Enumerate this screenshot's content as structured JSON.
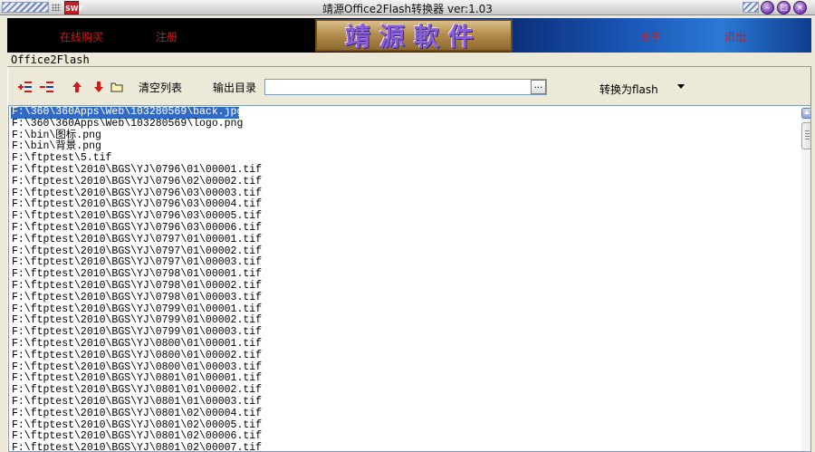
{
  "window": {
    "title": "靖源Office2Flash转换器 ver:1.03",
    "app_icon_text": "SWF",
    "buttons": [
      "minimize",
      "maximize",
      "close"
    ]
  },
  "banner": {
    "buy_online": "在线购买",
    "register": "注册",
    "logo_text": "靖源軟件",
    "about": "关于",
    "exit": "退出"
  },
  "tab": {
    "label": "Office2Flash"
  },
  "toolbar": {
    "add_files_icon": "add-files-icon",
    "remove_files_icon": "remove-files-icon",
    "move_up_icon": "arrow-up-icon",
    "move_down_icon": "arrow-down-icon",
    "folder_icon": "folder-icon",
    "clear_list_label": "清空列表",
    "output_dir_label": "输出目录",
    "output_dir_value": "",
    "browse_label": "...",
    "convert_label": "转换为flash"
  },
  "file_list": {
    "selected_index": 0,
    "items": [
      "F:\\360\\360Apps\\Web\\103280569\\back.jpg",
      "F:\\360\\360Apps\\Web\\103280569\\logo.png",
      "F:\\bin\\图标.png",
      "F:\\bin\\背景.png",
      "F:\\ftptest\\5.tif",
      "F:\\ftptest\\2010\\BGS\\YJ\\0796\\01\\00001.tif",
      "F:\\ftptest\\2010\\BGS\\YJ\\0796\\02\\00002.tif",
      "F:\\ftptest\\2010\\BGS\\YJ\\0796\\03\\00003.tif",
      "F:\\ftptest\\2010\\BGS\\YJ\\0796\\03\\00004.tif",
      "F:\\ftptest\\2010\\BGS\\YJ\\0796\\03\\00005.tif",
      "F:\\ftptest\\2010\\BGS\\YJ\\0796\\03\\00006.tif",
      "F:\\ftptest\\2010\\BGS\\YJ\\0797\\01\\00001.tif",
      "F:\\ftptest\\2010\\BGS\\YJ\\0797\\01\\00002.tif",
      "F:\\ftptest\\2010\\BGS\\YJ\\0797\\01\\00003.tif",
      "F:\\ftptest\\2010\\BGS\\YJ\\0798\\01\\00001.tif",
      "F:\\ftptest\\2010\\BGS\\YJ\\0798\\01\\00002.tif",
      "F:\\ftptest\\2010\\BGS\\YJ\\0798\\01\\00003.tif",
      "F:\\ftptest\\2010\\BGS\\YJ\\0799\\01\\00001.tif",
      "F:\\ftptest\\2010\\BGS\\YJ\\0799\\01\\00002.tif",
      "F:\\ftptest\\2010\\BGS\\YJ\\0799\\01\\00003.tif",
      "F:\\ftptest\\2010\\BGS\\YJ\\0800\\01\\00001.tif",
      "F:\\ftptest\\2010\\BGS\\YJ\\0800\\01\\00002.tif",
      "F:\\ftptest\\2010\\BGS\\YJ\\0800\\01\\00003.tif",
      "F:\\ftptest\\2010\\BGS\\YJ\\0801\\01\\00001.tif",
      "F:\\ftptest\\2010\\BGS\\YJ\\0801\\01\\00002.tif",
      "F:\\ftptest\\2010\\BGS\\YJ\\0801\\01\\00003.tif",
      "F:\\ftptest\\2010\\BGS\\YJ\\0801\\02\\00004.tif",
      "F:\\ftptest\\2010\\BGS\\YJ\\0801\\02\\00005.tif",
      "F:\\ftptest\\2010\\BGS\\YJ\\0801\\02\\00006.tif",
      "F:\\ftptest\\2010\\BGS\\YJ\\0801\\02\\00007.tif"
    ]
  },
  "colors": {
    "selection": "#316ac5",
    "banner_link": "#d11a1a",
    "logo_text": "#8a5ed8"
  }
}
